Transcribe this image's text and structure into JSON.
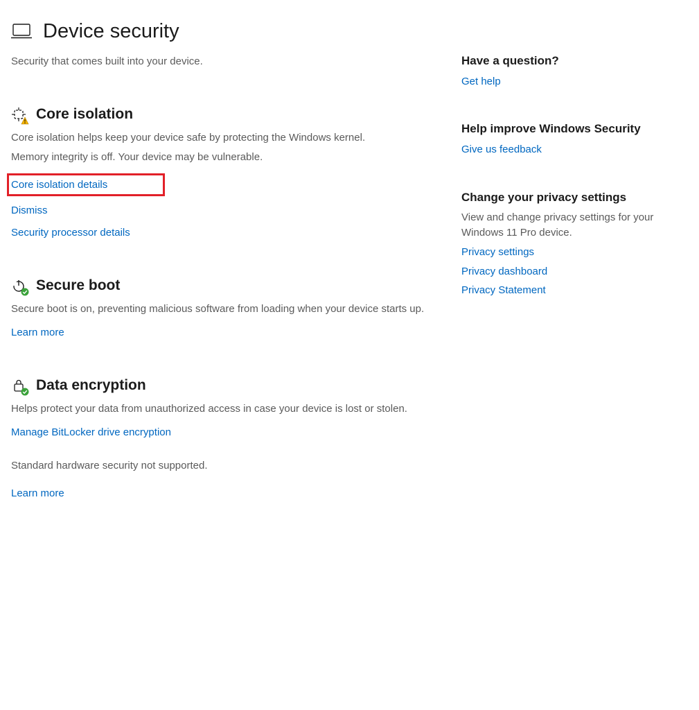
{
  "page": {
    "title": "Device security",
    "subtitle": "Security that comes built into your device."
  },
  "sections": {
    "core_isolation": {
      "title": "Core isolation",
      "desc": "Core isolation helps keep your device safe by protecting the Windows kernel.",
      "warning": "Memory integrity is off. Your device may be vulnerable.",
      "link_details": "Core isolation details",
      "link_dismiss": "Dismiss",
      "link_sec_processor": "Security processor details"
    },
    "secure_boot": {
      "title": "Secure boot",
      "desc": "Secure boot is on, preventing malicious software from loading when your device starts up.",
      "link_learn": "Learn more"
    },
    "data_encryption": {
      "title": "Data encryption",
      "desc": "Helps protect your data from unauthorized access in case your device is lost or stolen.",
      "link_bitlocker": "Manage BitLocker drive encryption"
    },
    "standard": {
      "text": "Standard hardware security not supported.",
      "link_learn": "Learn more"
    }
  },
  "sidebar": {
    "question": {
      "heading": "Have a question?",
      "link": "Get help"
    },
    "improve": {
      "heading": "Help improve Windows Security",
      "link": "Give us feedback"
    },
    "privacy": {
      "heading": "Change your privacy settings",
      "text": "View and change privacy settings for your Windows 11 Pro device.",
      "links": [
        "Privacy settings",
        "Privacy dashboard",
        "Privacy Statement"
      ]
    }
  },
  "colors": {
    "link": "#0067c0",
    "highlight": "#e22028",
    "warn_badge": "#f7b500",
    "ok_badge": "#3aa23a"
  }
}
